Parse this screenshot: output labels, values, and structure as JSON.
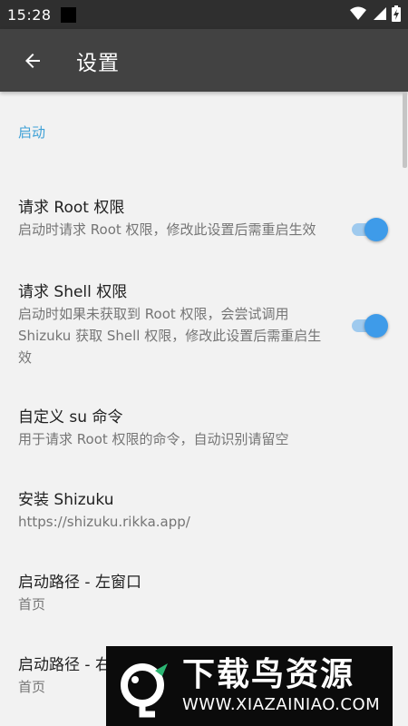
{
  "status_bar": {
    "time": "15:28"
  },
  "app_bar": {
    "title": "设置"
  },
  "section": {
    "label": "启动"
  },
  "preferences": [
    {
      "title": "请求 Root 权限",
      "summary": "启动时请求 Root 权限，修改此设置后需重启生效",
      "switch_on": true
    },
    {
      "title": "请求 Shell 权限",
      "summary": "启动时如果未获取到 Root 权限，会尝试调用 Shizuku 获取 Shell 权限，修改此设置后需重启生效",
      "switch_on": true
    },
    {
      "title": "自定义 su 命令",
      "summary": "用于请求 Root 权限的命令，自动识别请留空"
    },
    {
      "title": "安装 Shizuku",
      "summary": "https://shizuku.rikka.app/"
    },
    {
      "title": "启动路径 - 左窗口",
      "summary": "首页"
    },
    {
      "title": "启动路径 - 右窗口",
      "summary": "首页"
    }
  ],
  "watermark": {
    "brand": "下载鸟资源",
    "url": "WWW.XIAZAINIAO.COM"
  },
  "colors": {
    "status_bar": "#2f2f2f",
    "app_bar": "#424242",
    "background": "#f2f2f2",
    "accent": "#3e9be9",
    "section_header": "#3ea0d6"
  }
}
